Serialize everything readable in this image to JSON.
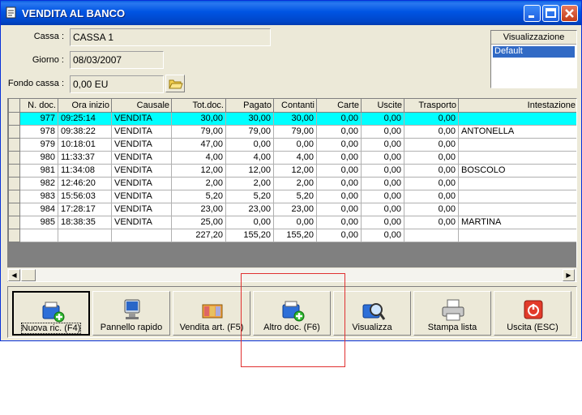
{
  "window": {
    "title": "VENDITA AL BANCO"
  },
  "form": {
    "cassa_label": "Cassa :",
    "cassa_value": "CASSA 1",
    "giorno_label": "Giorno :",
    "giorno_value": "08/03/2007",
    "fondo_label": "Fondo cassa :",
    "fondo_value": "0,00 EU"
  },
  "visualizzazione": {
    "header": "Visualizzazione",
    "items": [
      "Default"
    ]
  },
  "grid": {
    "columns": [
      "N. doc.",
      "Ora inizio",
      "Causale",
      "Tot.doc.",
      "Pagato",
      "Contanti",
      "Carte",
      "Uscite",
      "Trasporto",
      "Intestazione"
    ],
    "rows": [
      [
        "977",
        "09:25:14",
        "VENDITA",
        "30,00",
        "30,00",
        "30,00",
        "0,00",
        "0,00",
        "0,00",
        ""
      ],
      [
        "978",
        "09:38:22",
        "VENDITA",
        "79,00",
        "79,00",
        "79,00",
        "0,00",
        "0,00",
        "0,00",
        "ANTONELLA"
      ],
      [
        "979",
        "10:18:01",
        "VENDITA",
        "47,00",
        "0,00",
        "0,00",
        "0,00",
        "0,00",
        "0,00",
        ""
      ],
      [
        "980",
        "11:33:37",
        "VENDITA",
        "4,00",
        "4,00",
        "4,00",
        "0,00",
        "0,00",
        "0,00",
        ""
      ],
      [
        "981",
        "11:34:08",
        "VENDITA",
        "12,00",
        "12,00",
        "12,00",
        "0,00",
        "0,00",
        "0,00",
        "BOSCOLO"
      ],
      [
        "982",
        "12:46:20",
        "VENDITA",
        "2,00",
        "2,00",
        "2,00",
        "0,00",
        "0,00",
        "0,00",
        ""
      ],
      [
        "983",
        "15:56:03",
        "VENDITA",
        "5,20",
        "5,20",
        "5,20",
        "0,00",
        "0,00",
        "0,00",
        ""
      ],
      [
        "984",
        "17:28:17",
        "VENDITA",
        "23,00",
        "23,00",
        "23,00",
        "0,00",
        "0,00",
        "0,00",
        ""
      ],
      [
        "985",
        "18:38:35",
        "VENDITA",
        "25,00",
        "0,00",
        "0,00",
        "0,00",
        "0,00",
        "0,00",
        "MARTINA"
      ]
    ],
    "totals": [
      "",
      "",
      "",
      "227,20",
      "155,20",
      "155,20",
      "0,00",
      "0,00",
      "",
      ""
    ],
    "selected_row": 0
  },
  "toolbar": {
    "buttons": [
      {
        "label": "Nuova ric. (F4)",
        "icon": "new-receipt-icon"
      },
      {
        "label": "Pannello rapido",
        "icon": "monitor-icon"
      },
      {
        "label": "Vendita art. (F5)",
        "icon": "articles-icon"
      },
      {
        "label": "Altro doc. (F6)",
        "icon": "other-document-icon"
      },
      {
        "label": "Visualizza",
        "icon": "view-search-icon"
      },
      {
        "label": "Stampa lista",
        "icon": "printer-icon"
      },
      {
        "label": "Uscita (ESC)",
        "icon": "exit-icon"
      }
    ]
  },
  "colors": {
    "title_bar": "#0054e3",
    "selected_row": "#00ffff",
    "selection": "#316ac5",
    "highlight_box": "#e03030"
  }
}
